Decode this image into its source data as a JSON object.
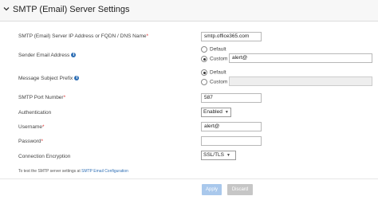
{
  "section": {
    "title": "SMTP (Email) Server Settings"
  },
  "fields": {
    "server": {
      "label": "SMTP (Email) Server IP Address or FQDN / DNS Name",
      "required_mark": "*",
      "value": "smtp.office365.com"
    },
    "sender": {
      "label": "Sender Email Address",
      "option_default": "Default",
      "option_custom": "Custom",
      "selected": "Custom",
      "custom_value": "alert@"
    },
    "subject": {
      "label": "Message Subject Prefix",
      "option_default": "Default",
      "option_custom": "Custom",
      "selected": "Default",
      "custom_value": ""
    },
    "port": {
      "label": "SMTP Port Number",
      "required_mark": "*",
      "value": "587"
    },
    "authentication": {
      "label": "Authentication",
      "value": "Enabled"
    },
    "username": {
      "label": "Username",
      "required_mark": "*",
      "value": "alert@"
    },
    "password": {
      "label": "Password",
      "required_mark": "*",
      "value": ""
    },
    "encryption": {
      "label": "Connection Encryption",
      "value": "SSL/TLS"
    }
  },
  "note": {
    "text": "To test the SMTP server settings at",
    "link": "SMTP Email Configuration"
  },
  "buttons": {
    "apply": "Apply",
    "discard": "Discard"
  },
  "colors": {
    "info_icon": "#2f6fb5",
    "required": "#e03030",
    "apply_disabled": "#a9c8ec",
    "discard_disabled": "#c6c6c6"
  }
}
